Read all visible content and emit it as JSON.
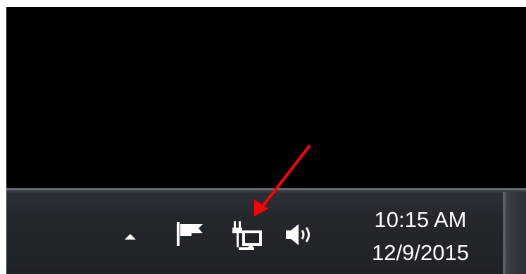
{
  "taskbar": {
    "notification_area": {
      "show_hidden_icon": "up-triangle-icon",
      "icons": [
        {
          "name": "action-center-flag-icon"
        },
        {
          "name": "network-icon"
        },
        {
          "name": "volume-icon"
        }
      ]
    },
    "clock": {
      "time": "10:15 AM",
      "date": "12/9/2015"
    }
  },
  "annotation": {
    "arrow_color": "#ff0000",
    "points_to": "network-icon"
  },
  "colors": {
    "desktop": "#000000",
    "taskbar": "#24282d",
    "text": "#ffffff"
  }
}
